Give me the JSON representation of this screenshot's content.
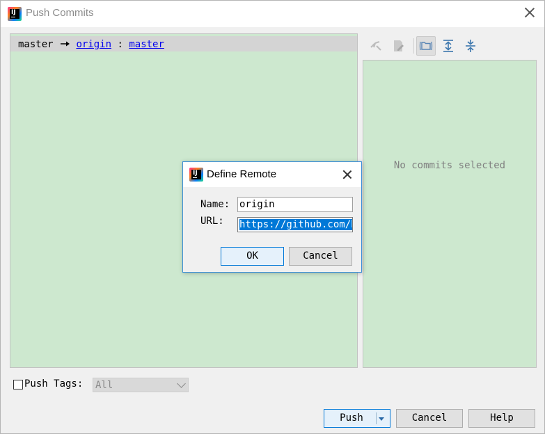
{
  "window": {
    "title": "Push Commits"
  },
  "push_row": {
    "local_branch": "master",
    "remote": "origin",
    "separator": ":",
    "remote_branch": "master"
  },
  "toolbar": {
    "icons": [
      "cherry-pick-icon",
      "edit-source-icon",
      "group-by-repo-icon",
      "expand-all-icon",
      "collapse-all-icon"
    ]
  },
  "details": {
    "empty_text": "No commits selected"
  },
  "push_tags": {
    "label": "Push Tags:",
    "checked": false,
    "combo_value": "All"
  },
  "buttons": {
    "push": "Push",
    "cancel": "Cancel",
    "help": "Help"
  },
  "define_remote": {
    "title": "Define Remote",
    "name_label": "Name:",
    "name_value": "origin",
    "url_label": "URL:",
    "url_value": "https://github.com/h",
    "ok": "OK",
    "cancel": "Cancel"
  },
  "colors": {
    "panel_bg": "#cde8cf",
    "link": "#0000ee",
    "selection": "#0078d7",
    "focus_border": "#0078d7"
  }
}
